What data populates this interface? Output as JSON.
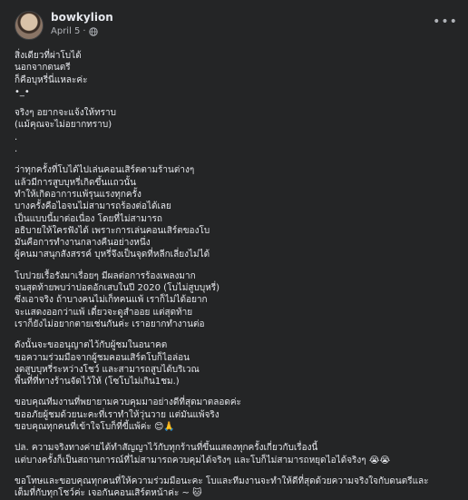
{
  "post": {
    "author": "bowkylion",
    "date": "April 5",
    "separator": "·",
    "privacy_icon": "globe-icon",
    "more_icon": "ellipsis-icon"
  },
  "paragraphs": [
    [
      "สิ่งเดียวที่ผ่าโบได้",
      "นอกจากดนตรี",
      "ก็คือบุหรี่นี่แหละค่ะ",
      "•_•"
    ],
    [
      "จริงๆ อยากจะแจ้งให้ทราบ",
      "(แม้คุณจะไม่อยากทราบ)",
      ".",
      "."
    ],
    [
      "ว่าทุกครั้งที่โบได้ไปเล่นคอนเสิร์ตตามร้านต่างๆ",
      "แล้วมีการสูบบุหรี่เกิดขึ้นแถวนั้น",
      "ทำให้เกิดอาการแพ้รุนแรงทุกครั้ง",
      "บางครั้งคือไอจนไม่สามารถร้องต่อได้เลย",
      "เป็นแบบนี้มาต่อเนื่อง โดยที่ไม่สามารถ",
      "อธิบายให้ใครฟังได้ เพราะการเล่นคอนเสิร์ตของโบ",
      "มันคือการทำงานกลางคืนอย่างหนึ่ง",
      "ผู้คนมาสนุกสังสรรค์ บุหรี่จึงเป็นจุดที่หลีกเลี่ยงไม่ได้"
    ],
    [
      "โบปวยเรื้อรังมาเรื่อยๆ มีผลต่อการร้องเพลงมาก",
      "จนสุดท้ายพบว่าปอดอักเสบในปี 2020 (โบไม่สูบบุหรี่)",
      "ซึ่งเอาจริง ถ้าบางคนไม่เก็ทคนแพ้ เราก็ไม่ได้อยาก",
      "จะแสดงออกว่าแพ้ เดี๋ยวจะดูสำออย แต่สุดท้าย",
      "เราก็ยังไม่อยากตายเช่นกันค่ะ เราอยากทำงานต่อ"
    ],
    [
      "ดังนั้นจะขออนุญาตไว้กับผู้ชมในอนาคต",
      "ขอความร่วมมือจากผู้ชมคอนเสิร์ตโบก็ไอล่อน",
      "งดสูบบุหรี่ระหว่างโชว์ และสามารถสูบได้บริเวณ",
      "พื้นที่ที่ทางร้านจัดไว้ให้ (โซโบไม่เกิน1ชม.)"
    ],
    [
      "ขอบคุณทีมงานที่พยายามควบคุมมาอย่างดีที่สุดมาตลอดค่ะ",
      "ขออภัยผู้ชมด้วยนะคะที่เราทำให้วุ่นวาย แต่มันแพ้จริง",
      "ขอบคุณทุกคนที่เข้าใจโบก็ที่ขี้แพ้ค่ะ 😊🙏"
    ],
    [
      "ปล. ความจริงทางค่ายได้ทำสัญญาไว้กับทุกร้านที่ขึ้นแสดงทุกครั้งเกี่ยวกับเรื่องนี้",
      "แต่บางครั้งก็เป็นสถานการณ์ที่ไม่สามารถควบคุมได้จริงๆ และโบก็ไม่สามารถหยุดไอได้จริงๆ 😭😭"
    ],
    [
      "ขอโทษและขอบคุณทุกคนที่ให้ความร่วมมือนะคะ โบและทีมงานจะทำให้ดีที่สุดด้วยความจริงใจกับดนตรีและ",
      "เต็มที่กับทุกโชว์ค่ะ เจอกันคอนเสิร์ตหน้าค่ะ ~ 🐱"
    ]
  ]
}
